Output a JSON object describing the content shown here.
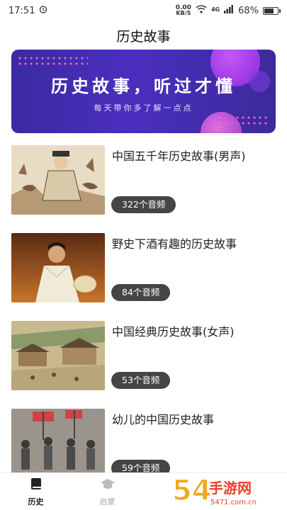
{
  "status_bar": {
    "time": "17:51",
    "net_speed_value": "0.00",
    "net_speed_unit": "KB/S",
    "network_type": "4G",
    "battery": "68%"
  },
  "header": {
    "title": "历史故事"
  },
  "banner": {
    "title": "历史故事，听过才懂",
    "subtitle": "每天带你多了解一点点"
  },
  "stories": [
    {
      "title": "中国五千年历史故事(男声)",
      "count": "322个音频",
      "thumbnail": "ancient-official-painting"
    },
    {
      "title": "野史下酒有趣的历史故事",
      "count": "84个音频",
      "thumbnail": "historical-figure-portrait"
    },
    {
      "title": "中国经典历史故事(女声)",
      "count": "53个音频",
      "thumbnail": "ancient-city-scroll"
    },
    {
      "title": "幼儿的中国历史故事",
      "count": "59个音频",
      "thumbnail": "historical-crowd-photo"
    }
  ],
  "tabs": [
    {
      "label": "历史",
      "icon": "book-icon",
      "active": true
    },
    {
      "label": "启蒙",
      "icon": "graduation-cap-icon",
      "active": false
    }
  ],
  "watermark": {
    "text": "54手游网",
    "sub": "5471.com.cn"
  },
  "colors": {
    "banner_bg": "#4a2fbf",
    "pill_bg": "#454548",
    "accent_pink": "#ff6fc7"
  }
}
